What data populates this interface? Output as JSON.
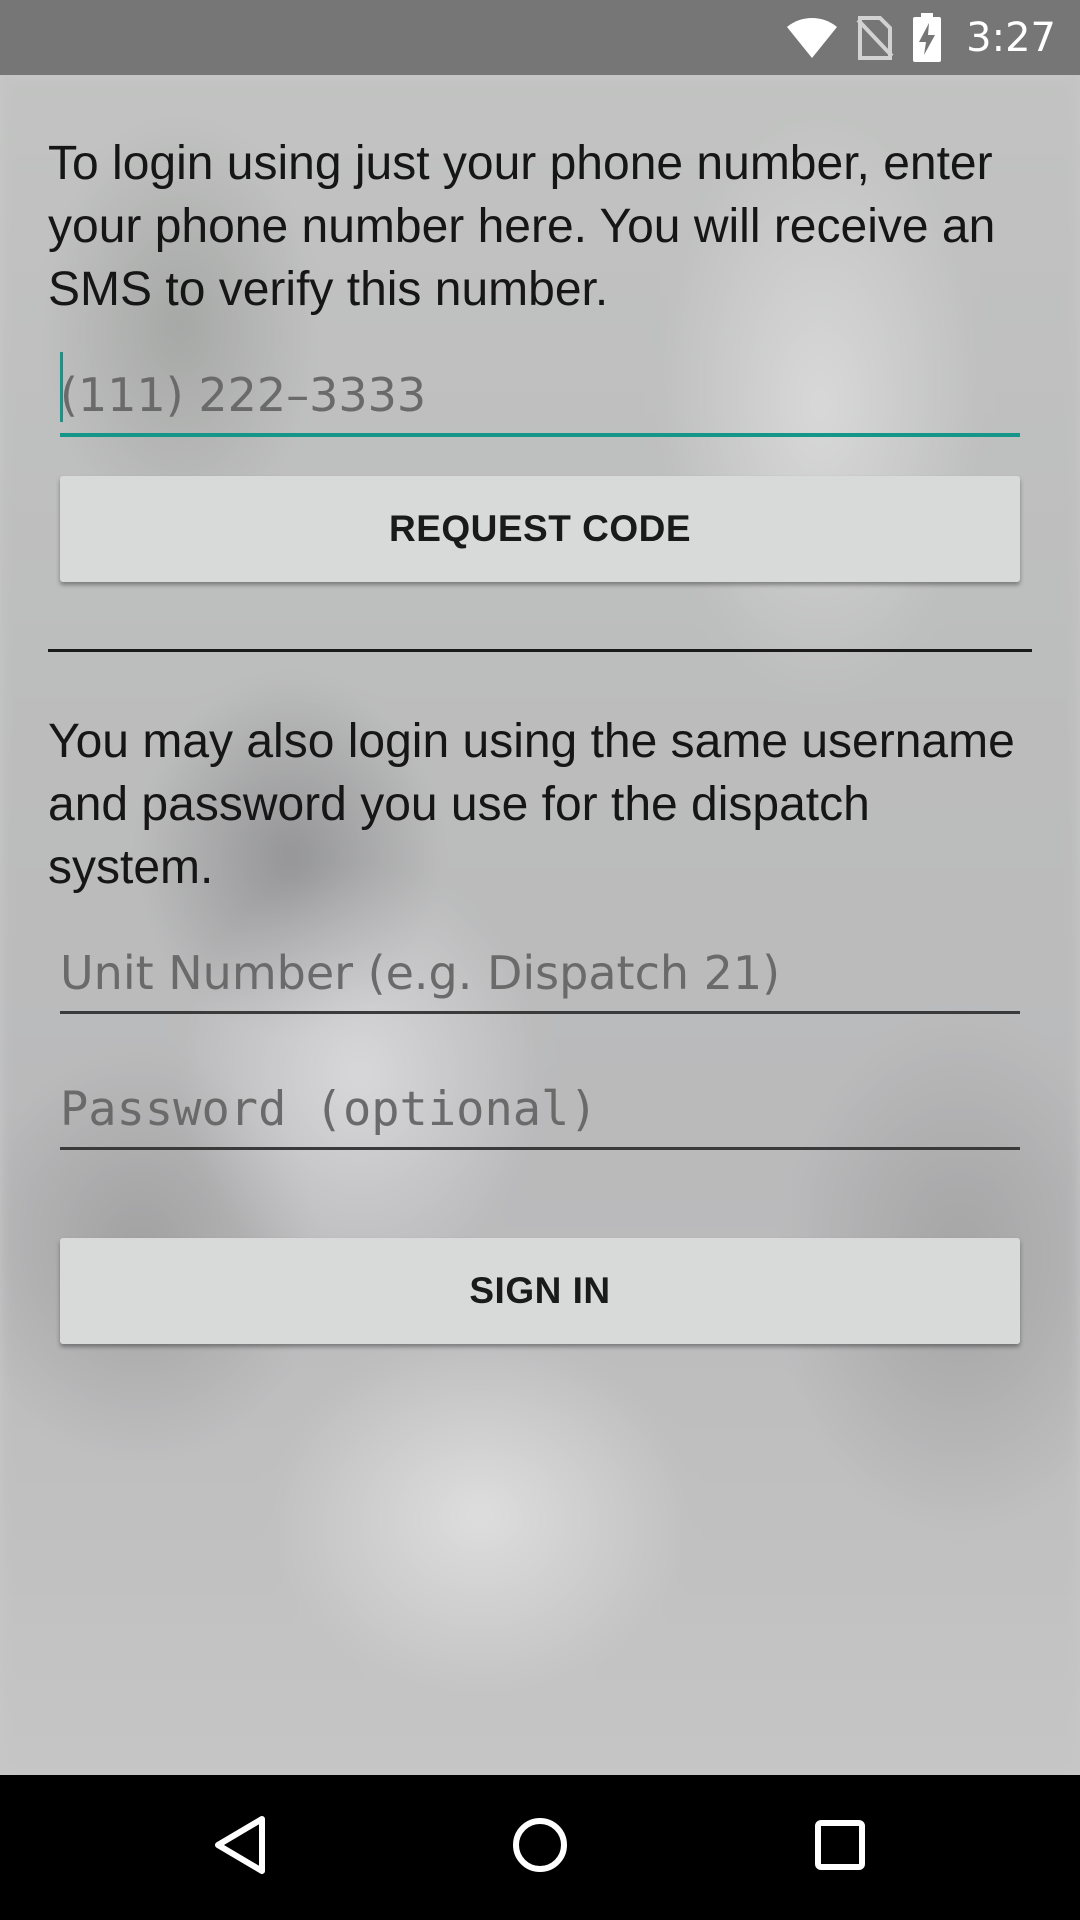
{
  "status_bar": {
    "time": "3:27",
    "icons": [
      "wifi-icon",
      "no-sim-icon",
      "battery-charging-icon"
    ]
  },
  "phone_login": {
    "instructions": "To login using just your phone number, enter your phone number here. You will receive an SMS to verify this number.",
    "phone_placeholder": "(111) 222–3333",
    "phone_value": "",
    "request_code_label": "REQUEST CODE"
  },
  "dispatch_login": {
    "instructions": "You may also login using the same username and password you use for the dispatch system.",
    "unit_placeholder": "Unit Number (e.g. Dispatch 21)",
    "unit_value": "",
    "password_placeholder": "Password (optional)",
    "password_value": "",
    "sign_in_label": "SIGN IN"
  },
  "nav_bar": {
    "icons": [
      "back-icon",
      "home-icon",
      "recents-icon"
    ]
  },
  "colors": {
    "accent": "#159688",
    "status_bar": "#767676",
    "button_bg": "#d8d9d9",
    "nav_bar": "#000000"
  }
}
